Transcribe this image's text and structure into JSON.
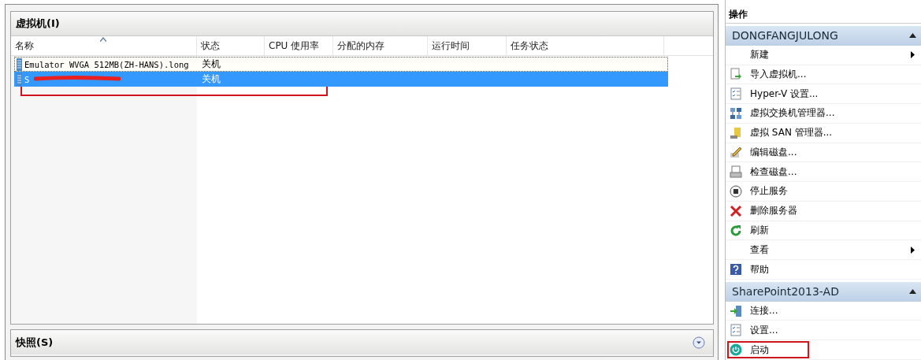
{
  "vm_panel": {
    "title": "虚拟机(I)",
    "columns": [
      {
        "label": "名称",
        "sorted": true
      },
      {
        "label": "状态",
        "sorted": false
      },
      {
        "label": "CPU 使用率",
        "sorted": false
      },
      {
        "label": "分配的内存",
        "sorted": false
      },
      {
        "label": "运行时间",
        "sorted": false
      },
      {
        "label": "任务状态",
        "sorted": false
      }
    ],
    "rows": [
      {
        "name": "Emulator WVGA 512MB(ZH-HANS).long",
        "state": "关机",
        "selected": false,
        "redacted": false,
        "annotated": false
      },
      {
        "name": "S",
        "state": "关机",
        "selected": true,
        "redacted": true,
        "annotated": true
      }
    ]
  },
  "snapshot_panel": {
    "title": "快照(S)",
    "expanded": false
  },
  "actions": {
    "title": "操作",
    "groups": [
      {
        "title": "DONGFANGJULONG",
        "expanded": true,
        "items": [
          {
            "label": "新建",
            "kind": "plain",
            "submenu": true,
            "annotated": false
          },
          {
            "label": "导入虚拟机...",
            "kind": "import",
            "submenu": false,
            "annotated": false
          },
          {
            "label": "Hyper-V 设置...",
            "kind": "settings",
            "submenu": false,
            "annotated": false
          },
          {
            "label": "虚拟交换机管理器...",
            "kind": "switch",
            "submenu": false,
            "annotated": false
          },
          {
            "label": "虚拟 SAN 管理器...",
            "kind": "san",
            "submenu": false,
            "annotated": false
          },
          {
            "label": "编辑磁盘...",
            "kind": "edit",
            "submenu": false,
            "annotated": false
          },
          {
            "label": "检查磁盘...",
            "kind": "inspect",
            "submenu": false,
            "annotated": false
          },
          {
            "label": "停止服务",
            "kind": "stop",
            "submenu": false,
            "annotated": false
          },
          {
            "label": "删除服务器",
            "kind": "delete",
            "submenu": false,
            "annotated": false
          },
          {
            "label": "刷新",
            "kind": "refresh",
            "submenu": false,
            "annotated": false
          },
          {
            "label": "查看",
            "kind": "plain",
            "submenu": true,
            "annotated": false
          },
          {
            "label": "帮助",
            "kind": "help",
            "submenu": false,
            "annotated": false
          }
        ]
      },
      {
        "title": "SharePoint2013-AD",
        "expanded": true,
        "items": [
          {
            "label": "连接...",
            "kind": "connect",
            "submenu": false,
            "annotated": false
          },
          {
            "label": "设置...",
            "kind": "settings",
            "submenu": false,
            "annotated": false
          },
          {
            "label": "启动",
            "kind": "power",
            "submenu": false,
            "annotated": true
          }
        ]
      }
    ]
  }
}
